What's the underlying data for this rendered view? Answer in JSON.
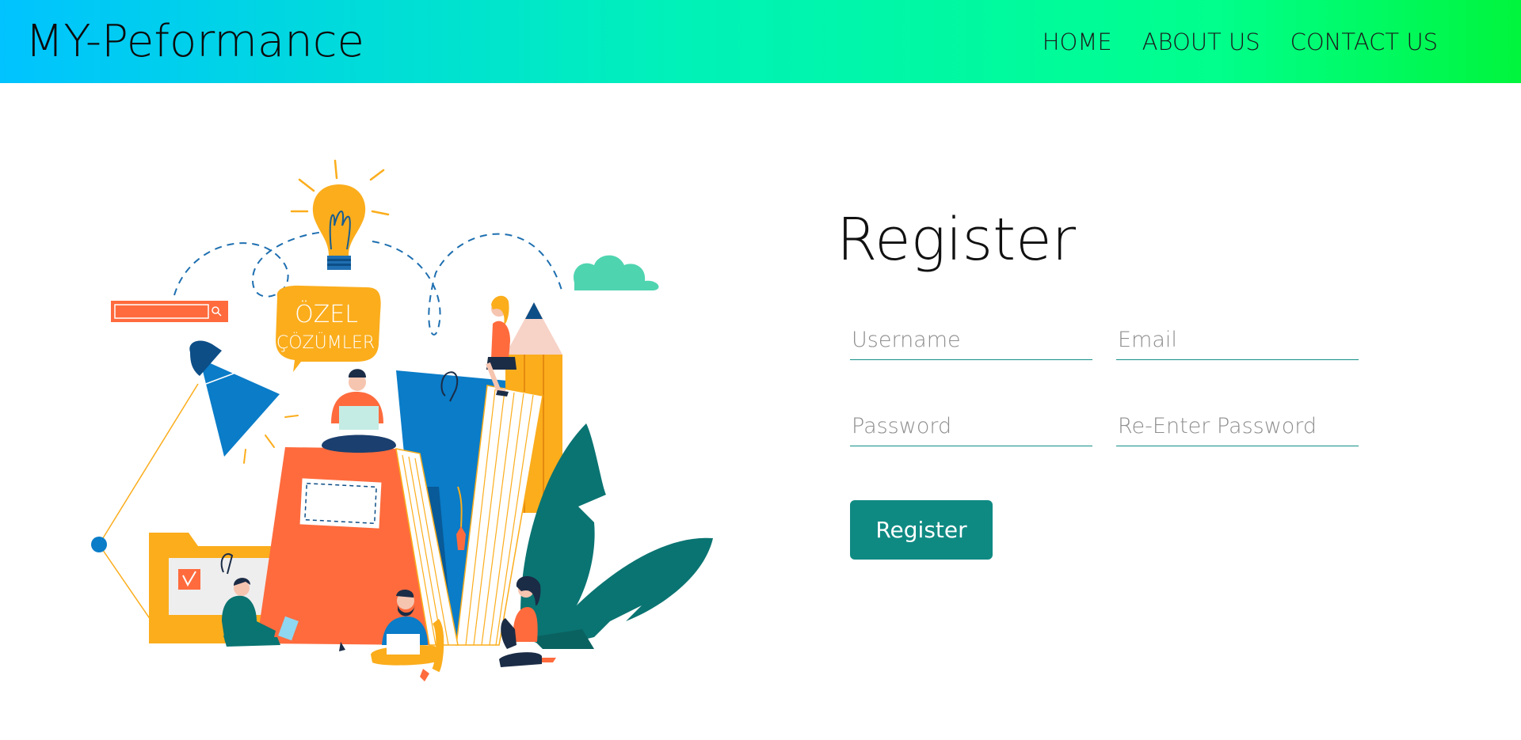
{
  "header": {
    "brand": "MY-Peformance",
    "nav": [
      "HOME",
      "ABOUT US",
      "CONTACT US"
    ]
  },
  "illustration": {
    "bubble_line1": "ÖZEL",
    "bubble_line2": "ÇÖZÜMLER"
  },
  "form": {
    "title": "Register",
    "username_placeholder": "Username",
    "email_placeholder": "Email",
    "password_placeholder": "Password",
    "repassword_placeholder": "Re-Enter Password",
    "submit_label": "Register"
  },
  "colors": {
    "accent": "#0f8a83",
    "orange": "#ff6b3d",
    "blue": "#0a7cc8",
    "yellow": "#fbad1c",
    "teal_leaf": "#0a7472"
  }
}
